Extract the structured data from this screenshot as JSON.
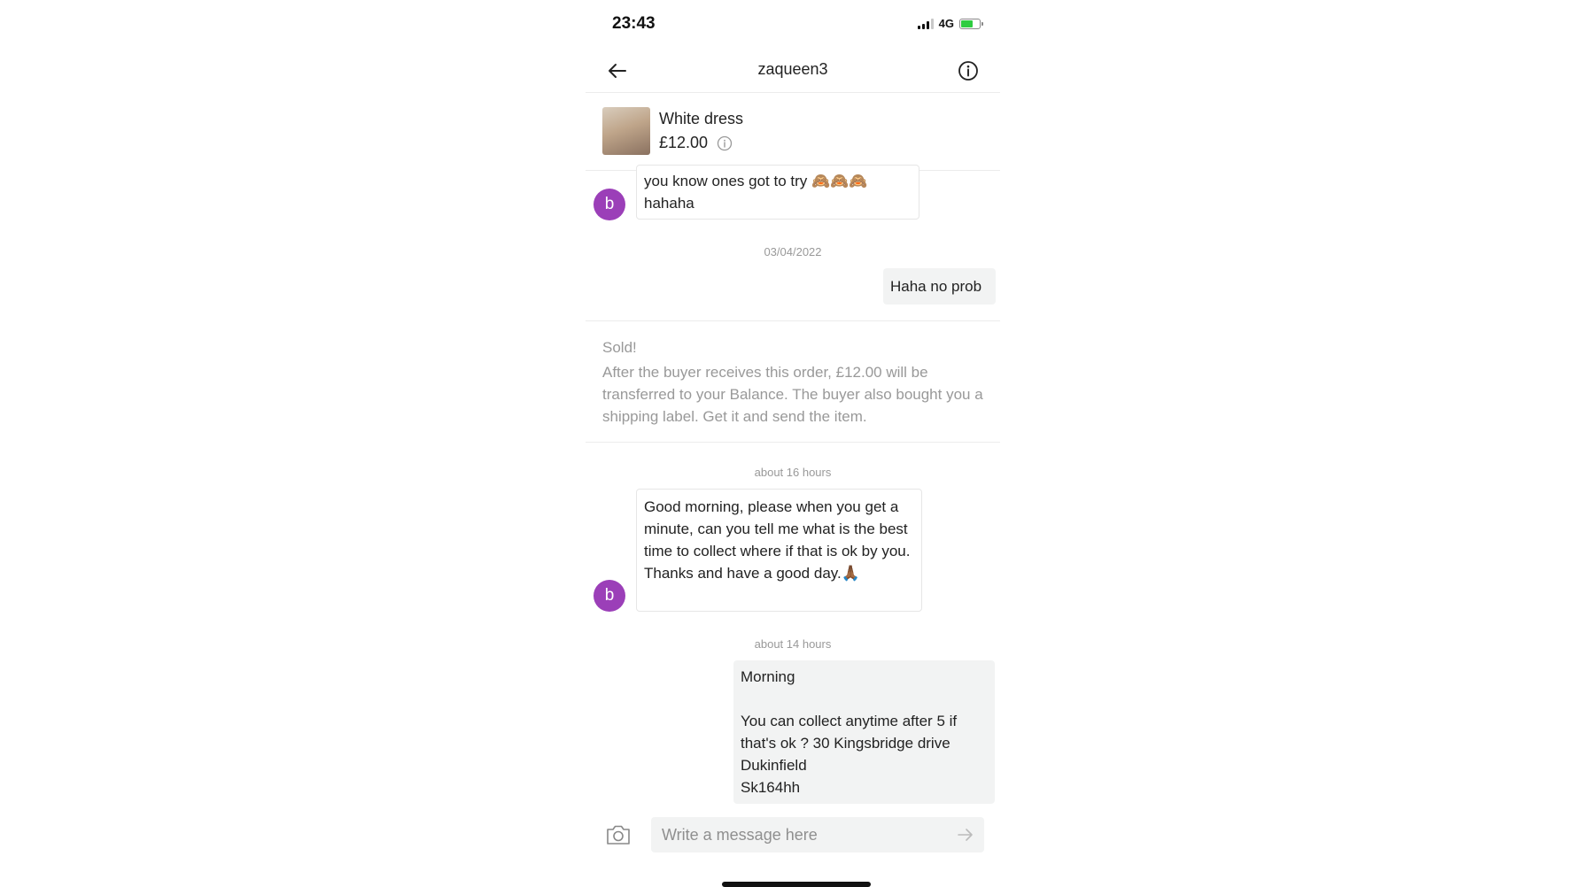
{
  "status_bar": {
    "time": "23:43",
    "network": "4G",
    "icons": [
      "signal-icon",
      "battery-charging-icon"
    ]
  },
  "header": {
    "title": "zaqueen3",
    "back_icon": "arrow-left-icon",
    "info_icon": "info-icon"
  },
  "item": {
    "name": "White dress",
    "price": "£12.00"
  },
  "conversation": {
    "avatar_letter": "b",
    "avatar_color": "#9b3fb8",
    "messages": [
      {
        "from": "other",
        "text": "you know ones got to try 🙈🙈🙈\nhahaha"
      },
      {
        "type": "date",
        "text": "03/04/2022"
      },
      {
        "from": "me",
        "text": "Haha no prob"
      },
      {
        "type": "system",
        "title": "Sold!",
        "text": "After the buyer receives this order, £12.00 will be transferred to your Balance. The buyer also bought you a shipping label. Get it and send the item."
      },
      {
        "type": "date",
        "text": "about 16 hours"
      },
      {
        "from": "other",
        "text": "Good morning, please when you get a minute, can you tell me what is the best time to collect where if that is ok by you. Thanks and have a good day.🙏🏾"
      },
      {
        "type": "date",
        "text": "about 14 hours"
      },
      {
        "from": "me",
        "text": "Morning\n\nYou can collect anytime after 5 if that's ok ? 30 Kingsbridge drive\nDukinfield\nSk164hh"
      }
    ]
  },
  "composer": {
    "placeholder": "Write a message here",
    "camera_icon": "camera-icon",
    "send_icon": "send-arrow-icon"
  }
}
